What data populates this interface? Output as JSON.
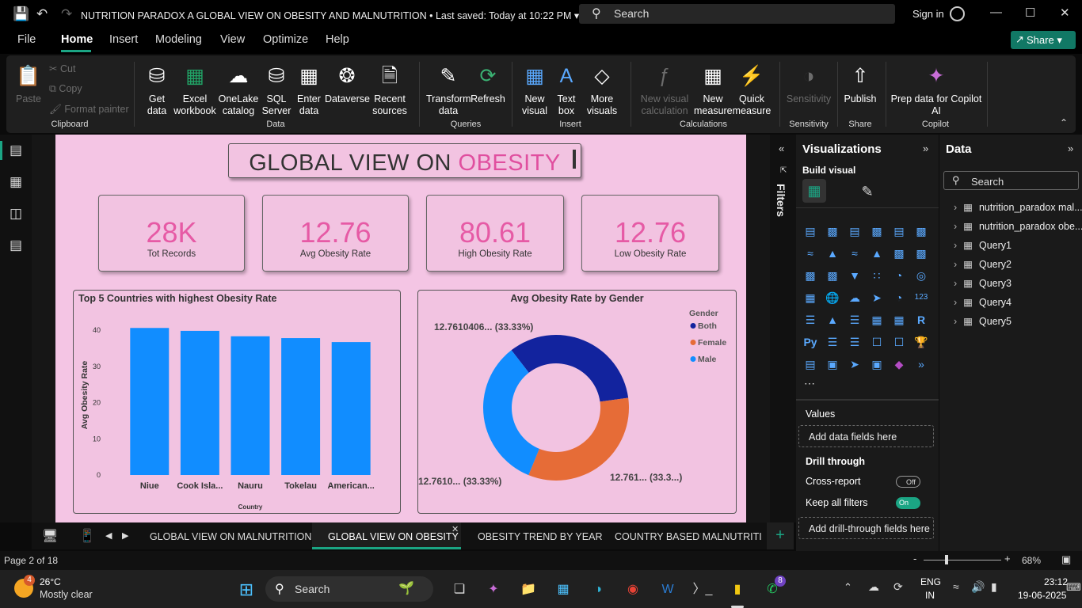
{
  "titlebar": {
    "document_title": "NUTRITION PARADOX A GLOBAL VIEW ON OBESITY AND MALNUTRITION",
    "saved": "Last saved: Today at 10:22 PM",
    "search": "Search",
    "signin": "Sign in"
  },
  "menu": {
    "file": "File",
    "home": "Home",
    "insert": "Insert",
    "modeling": "Modeling",
    "view": "View",
    "optimize": "Optimize",
    "help": "Help",
    "share": "Share"
  },
  "ribbon": {
    "clipboard": {
      "paste": "Paste",
      "cut": "Cut",
      "copy": "Copy",
      "format_painter": "Format painter",
      "group": "Clipboard"
    },
    "data": {
      "get_data": "Get data",
      "excel": "Excel workbook",
      "onelake": "OneLake catalog",
      "sql": "SQL Server",
      "enter": "Enter data",
      "dataverse": "Dataverse",
      "recent": "Recent sources",
      "group": "Data"
    },
    "queries": {
      "transform": "Transform data",
      "refresh": "Refresh",
      "group": "Queries"
    },
    "insert": {
      "new_visual": "New visual",
      "text_box": "Text box",
      "more_visuals": "More visuals",
      "group": "Insert"
    },
    "calculations": {
      "new_visual_calc": "New visual calculation",
      "new_measure": "New measure",
      "quick_measure": "Quick measure",
      "group": "Calculations"
    },
    "sensitivity": {
      "sensitivity": "Sensitivity",
      "group": "Sensitivity"
    },
    "share": {
      "publish": "Publish",
      "group": "Share"
    },
    "copilot": {
      "prep": "Prep data for Copilot AI",
      "group": "Copilot"
    }
  },
  "report": {
    "title_part1": "GLOBAL VIEW ON ",
    "title_part2": "OBESITY",
    "cards": [
      {
        "value": "28K",
        "label": "Tot Records"
      },
      {
        "value": "12.76",
        "label": "Avg Obesity Rate"
      },
      {
        "value": "80.61",
        "label": "High Obesity Rate"
      },
      {
        "value": "12.76",
        "label": "Low Obesity Rate"
      }
    ]
  },
  "chart_data": [
    {
      "type": "bar",
      "title": "Top 5 Countries with highest Obesity Rate",
      "xlabel": "Country",
      "ylabel": "Avg Obesity Rate",
      "categories": [
        "Niue",
        "Cook Isla...",
        "Nauru",
        "Tokelau",
        "American..."
      ],
      "values": [
        40.6,
        39.8,
        38.3,
        37.8,
        36.7
      ],
      "ylim": [
        0,
        40
      ],
      "yticks": [
        0,
        10,
        20,
        30,
        40
      ],
      "color": "#118dff"
    },
    {
      "type": "pie",
      "title": "Avg Obesity Rate by Gender",
      "legend_title": "Gender",
      "slices": [
        {
          "name": "Both",
          "value": 33.33,
          "label": "12.7610406... (33.33%)",
          "color": "#12239e"
        },
        {
          "name": "Female",
          "value": 33.33,
          "label": "12.761... (33.3...)",
          "color": "#e66c37"
        },
        {
          "name": "Male",
          "value": 33.33,
          "label": "12.7610... (33.33%)",
          "color": "#118dff"
        }
      ]
    }
  ],
  "filters": {
    "label": "Filters"
  },
  "viz_pane": {
    "title": "Visualizations",
    "build": "Build visual",
    "values": "Values",
    "add_fields": "Add data fields here",
    "drill": "Drill through",
    "cross_report": "Cross-report",
    "cross_state": "Off",
    "keep_filters": "Keep all filters",
    "keep_state": "On",
    "add_drill": "Add drill-through fields here"
  },
  "data_pane": {
    "title": "Data",
    "search": "Search",
    "items": [
      "nutrition_paradox mal...",
      "nutrition_paradox obe...",
      "Query1",
      "Query2",
      "Query3",
      "Query4",
      "Query5"
    ]
  },
  "tabs": [
    "GLOBAL VIEW ON MALNUTRITION",
    "GLOBAL VIEW ON OBESITY",
    "OBESITY TREND BY YEAR",
    "COUNTRY BASED MALNUTRITION L"
  ],
  "status": {
    "page": "Page 2 of 18",
    "zoom": "68%"
  },
  "taskbar": {
    "temp": "26°C",
    "weather": "Mostly clear",
    "weather_badge": "4",
    "search": "Search",
    "lang1": "ENG",
    "lang2": "IN",
    "time": "23:12",
    "date": "19-06-2025",
    "whatsapp_badge": "8"
  }
}
